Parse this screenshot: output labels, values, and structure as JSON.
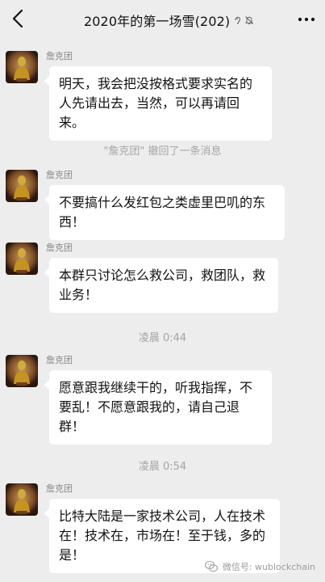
{
  "header": {
    "title": "2020年的第一场雪(202)"
  },
  "messages": [
    {
      "sender": "詹克团",
      "text": "明天，我会把没按格式要求实名的人先请出去，当然，可以再请回来。"
    },
    {
      "sender": "詹克团",
      "text": "不要搞什么发红包之类虚里巴叽的东西！"
    },
    {
      "sender": "詹克团",
      "text": "本群只讨论怎么救公司，救团队，救业务！"
    },
    {
      "sender": "詹克团",
      "text": "愿意跟我继续干的，听我指挥，不要乱！不愿意跟我的，请自己退群！"
    },
    {
      "sender": "詹克团",
      "text": "比特大陆是一家技术公司，人在技术在！技术在，市场在！至于钱，多的是！"
    }
  ],
  "system": {
    "recall": "\"詹克团\" 撤回了一条消息",
    "time1": "凌晨 0:44",
    "time2": "凌晨 0:54"
  },
  "watermark": {
    "text": "微信号: wublockchain"
  },
  "colors": {
    "background": "#ededed",
    "bubble": "#ffffff",
    "system_text": "#a5a5a5"
  }
}
